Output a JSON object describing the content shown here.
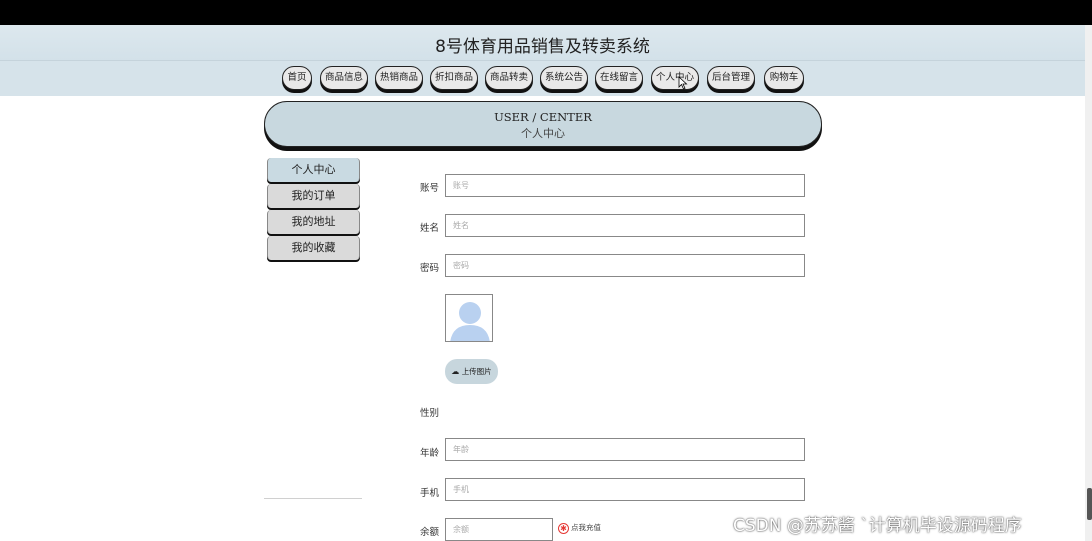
{
  "site": {
    "title": "8号体育用品销售及转卖系统"
  },
  "nav": {
    "items": [
      "首页",
      "商品信息",
      "热销商品",
      "折扣商品",
      "商品转卖",
      "系统公告",
      "在线留言",
      "个人中心",
      "后台管理",
      "购物车"
    ]
  },
  "banner": {
    "en": "USER / CENTER",
    "cn": "个人中心"
  },
  "sidebar": {
    "items": [
      "个人中心",
      "我的订单",
      "我的地址",
      "我的收藏"
    ]
  },
  "form": {
    "account": {
      "label": "账号",
      "placeholder": "账号"
    },
    "name": {
      "label": "姓名",
      "placeholder": "姓名"
    },
    "password": {
      "label": "密码",
      "placeholder": "密码"
    },
    "upload_label": "上传图片",
    "gender": {
      "label": "性别"
    },
    "age": {
      "label": "年龄",
      "placeholder": "年龄"
    },
    "phone": {
      "label": "手机",
      "placeholder": "手机"
    },
    "balance": {
      "label": "余额",
      "placeholder": "余额"
    },
    "recharge_label": "点我充值"
  },
  "watermark": "CSDN @苏苏酱    `计算机毕设源码程序",
  "colors": {
    "header_bg": "#d6e3ea",
    "button_bg": "#e9e9e9",
    "banner_bg": "#c8d8df",
    "accent_red": "#e53935"
  }
}
